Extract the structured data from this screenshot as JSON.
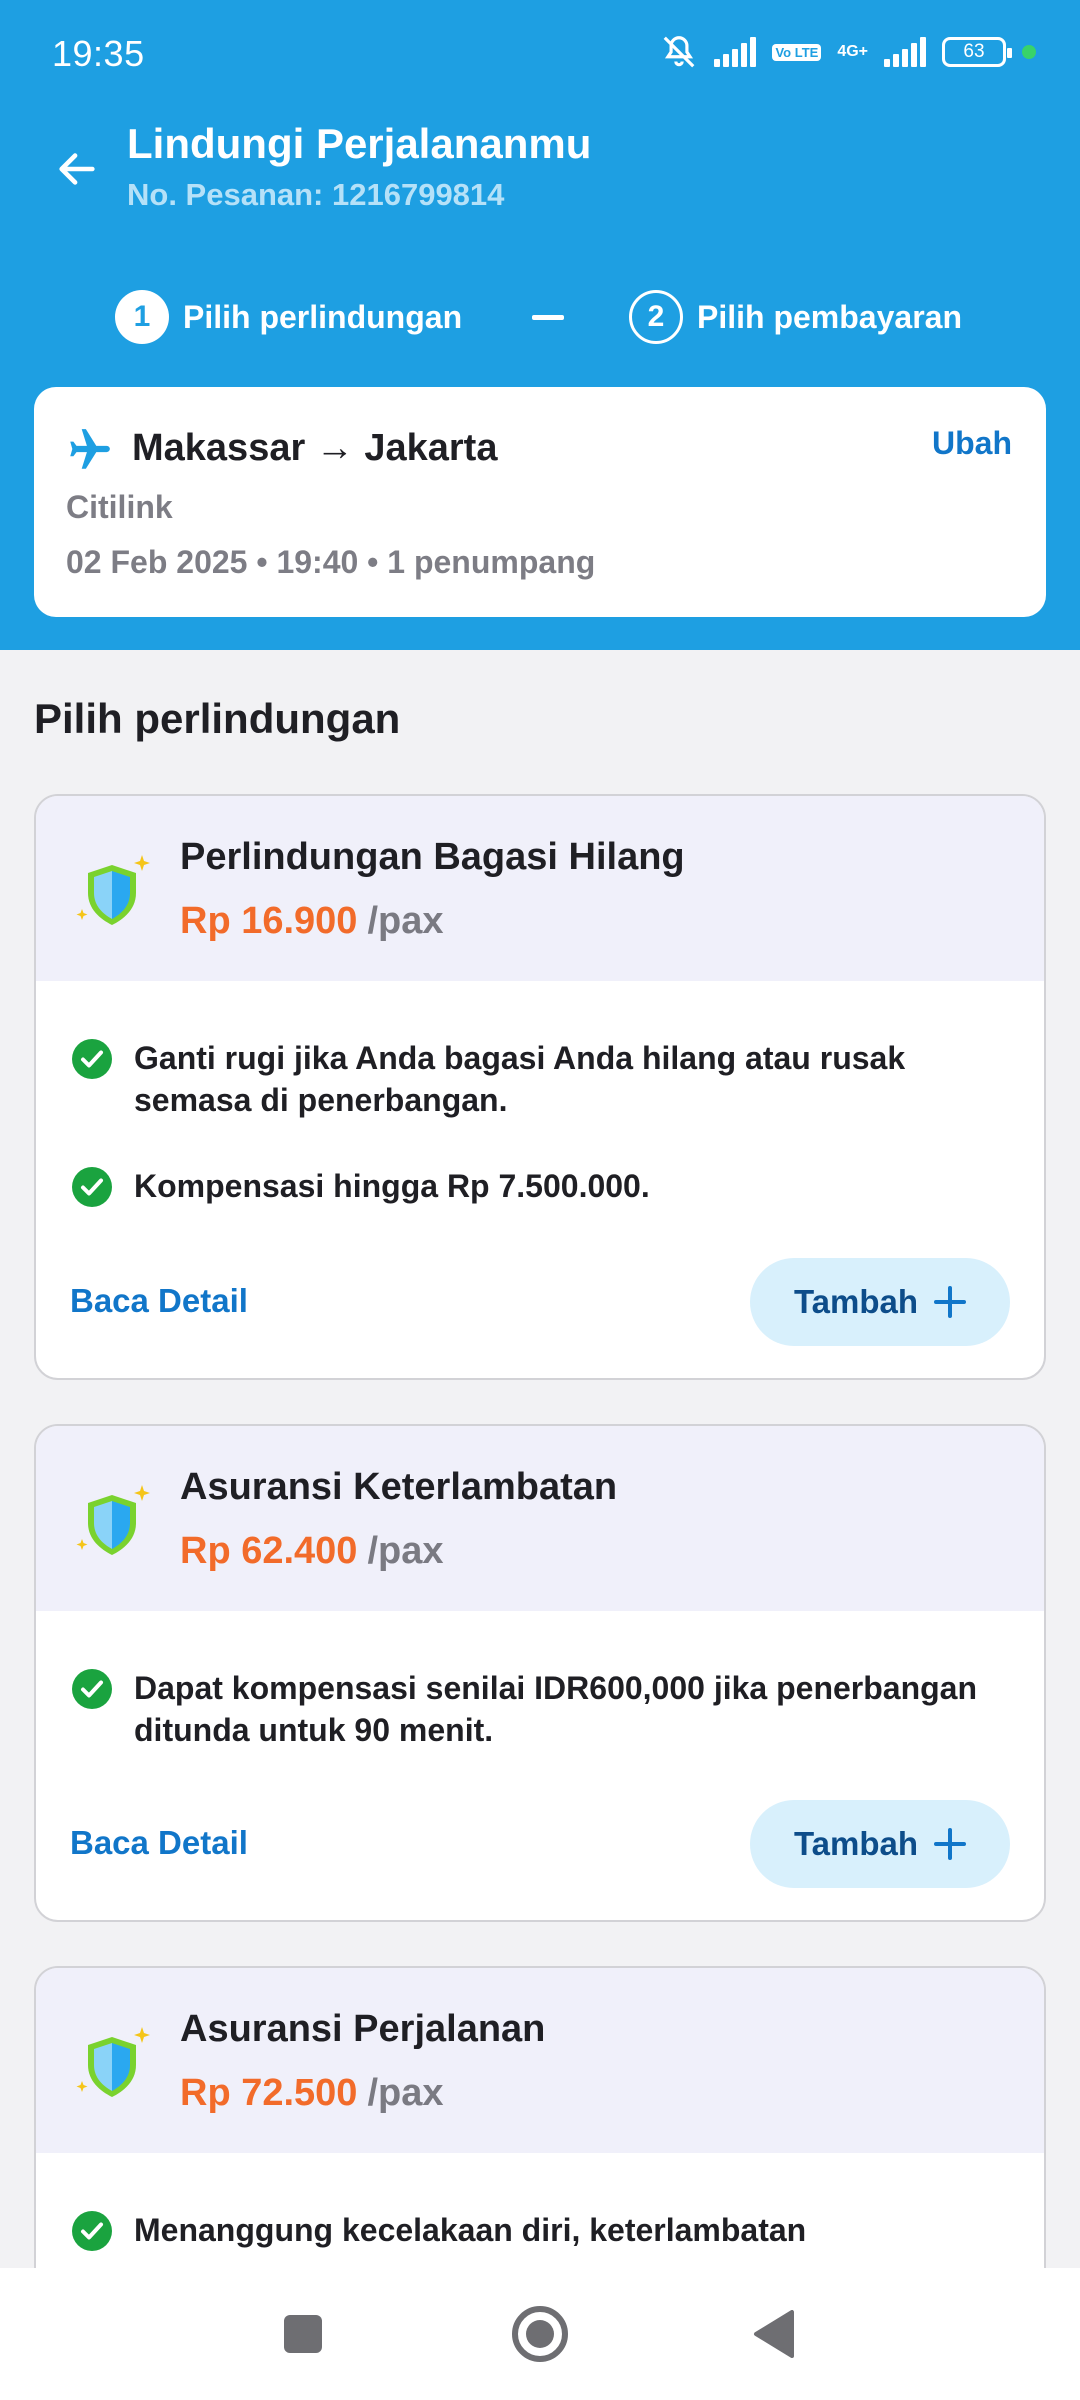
{
  "status_bar": {
    "time": "19:35",
    "battery": "63",
    "network_label": "4G+",
    "volte_label": "Vo LTE"
  },
  "header": {
    "title": "Lindungi Perjalananmu",
    "order_number": "No. Pesanan: 1216799814"
  },
  "stepper": [
    {
      "number": "1",
      "label": "Pilih perlindungan",
      "active": true
    },
    {
      "number": "2",
      "label": "Pilih pembayaran",
      "active": false
    }
  ],
  "flight": {
    "route": "Makassar → Jakarta",
    "airline": "Citilink",
    "details": "02 Feb 2025 • 19:40 • 1 penumpang",
    "edit_label": "Ubah"
  },
  "section_title": "Pilih perlindungan",
  "products": [
    {
      "name": "Perlindungan Bagasi Hilang",
      "price": "Rp 16.900",
      "unit": "/pax",
      "benefits": [
        "Ganti rugi jika Anda bagasi Anda hilang atau rusak semasa di penerbangan.",
        "Kompensasi hingga Rp 7.500.000."
      ],
      "detail_label": "Baca Detail",
      "add_label": "Tambah"
    },
    {
      "name": "Asuransi Keterlambatan",
      "price": "Rp 62.400",
      "unit": "/pax",
      "benefits": [
        "Dapat kompensasi senilai IDR600,000 jika penerbangan ditunda untuk 90 menit."
      ],
      "detail_label": "Baca Detail",
      "add_label": "Tambah"
    },
    {
      "name": "Asuransi Perjalanan",
      "price": "Rp 72.500",
      "unit": "/pax",
      "benefits": [
        "Menanggung kecelakaan diri, keterlambatan"
      ]
    }
  ],
  "colors": {
    "header_blue": "#1e9fe2",
    "price_orange": "#f26b2a",
    "link_blue": "#1176c9",
    "check_green": "#1aa33f"
  },
  "icons": [
    "back-arrow-icon",
    "plane-icon",
    "shield-icon",
    "check-circle-icon",
    "plus-icon",
    "mute-bell-icon",
    "signal-icon",
    "battery-icon"
  ]
}
